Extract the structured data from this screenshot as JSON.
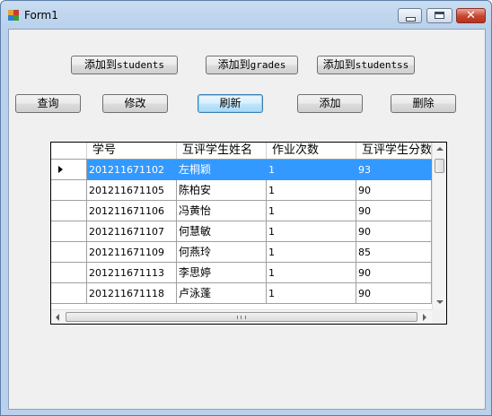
{
  "window": {
    "title": "Form1"
  },
  "buttons_row1": [
    {
      "prefix": "添加到",
      "suffix": "students"
    },
    {
      "prefix": "添加到",
      "suffix": "grades"
    },
    {
      "prefix": "添加到",
      "suffix": "studentss"
    }
  ],
  "buttons_row2": {
    "query": "查询",
    "modify": "修改",
    "refresh": "刷新",
    "add": "添加",
    "delete": "删除"
  },
  "grid": {
    "columns": [
      "学号",
      "互评学生姓名",
      "作业次数",
      "互评学生分数"
    ],
    "rows": [
      [
        "201211671102",
        "左桐颖",
        "1",
        "93"
      ],
      [
        "201211671105",
        "陈柏安",
        "1",
        "90"
      ],
      [
        "201211671106",
        "冯黄怡",
        "1",
        "90"
      ],
      [
        "201211671107",
        "何慧敏",
        "1",
        "90"
      ],
      [
        "201211671109",
        "何燕玲",
        "1",
        "85"
      ],
      [
        "201211671113",
        "李思婷",
        "1",
        "90"
      ],
      [
        "201211671118",
        "卢泳蓬",
        "1",
        "90"
      ]
    ],
    "selected_row": 0
  },
  "colors": {
    "selection": "#3399ff",
    "close_button": "#c6442e"
  }
}
